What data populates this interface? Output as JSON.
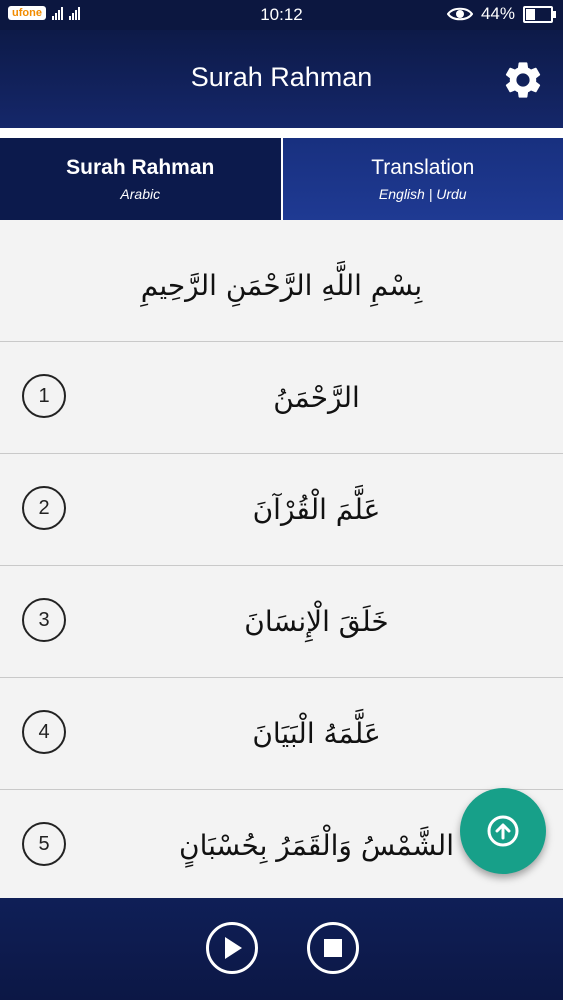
{
  "status_bar": {
    "carrier": "ufone",
    "time": "10:12",
    "battery": "44%"
  },
  "header": {
    "title": "Surah Rahman",
    "settings_icon": "gear-icon"
  },
  "tabs": [
    {
      "label": "Surah Rahman",
      "sublabel": "Arabic",
      "active": true
    },
    {
      "label": "Translation",
      "sublabel": "English | Urdu",
      "active": false
    }
  ],
  "bismillah": "بِسْمِ اللَّهِ الرَّحْمَنِ الرَّحِيمِ",
  "verses": [
    {
      "number": "1",
      "text": "الرَّحْمَنُ"
    },
    {
      "number": "2",
      "text": "عَلَّمَ الْقُرْآنَ"
    },
    {
      "number": "3",
      "text": "خَلَقَ الْإِنسَانَ"
    },
    {
      "number": "4",
      "text": "عَلَّمَهُ الْبَيَانَ"
    },
    {
      "number": "5",
      "text": "الشَّمْسُ وَالْقَمَرُ بِحُسْبَانٍ"
    }
  ],
  "fab_icon": "arrow-up-circle-icon",
  "controls": {
    "play_icon": "play-icon",
    "stop_icon": "stop-icon"
  },
  "colors": {
    "header_dark": "#0d1a48",
    "tab_inactive": "#1f3a93",
    "fab": "#17a089",
    "list_bg": "#f3f3f3"
  }
}
